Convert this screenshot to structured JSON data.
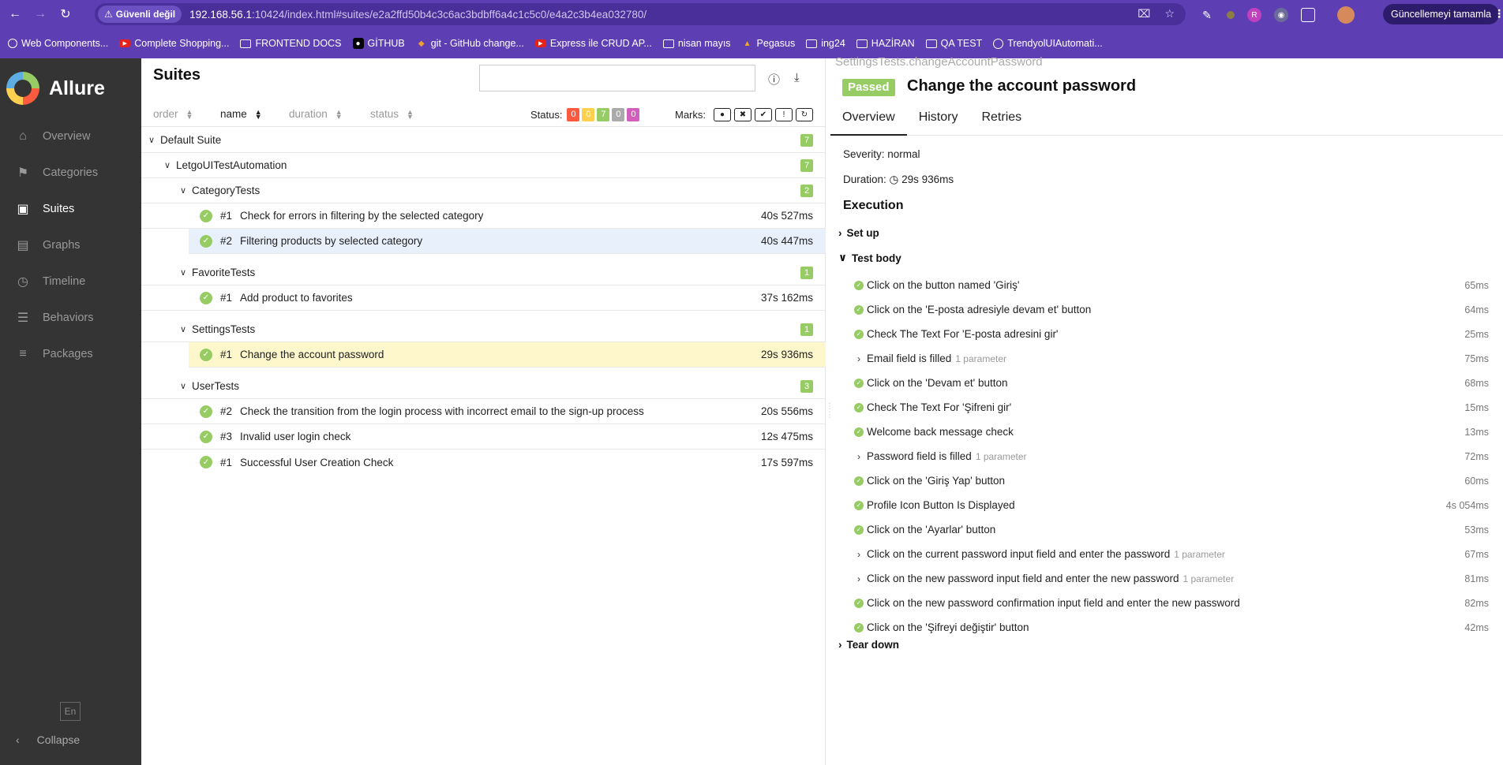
{
  "browser": {
    "security_label": "Güvenli değil",
    "url_host": "192.168.56.1",
    "url_rest": ":10424/index.html#suites/e2a2ffd50b4c3c6ac3bdbff6a4c1c5c0/e4a2c3b4ea032780/",
    "update_label": "Güncellemeyi tamamla",
    "bookmarks": [
      {
        "label": "Web Components..."
      },
      {
        "label": "Complete Shopping..."
      },
      {
        "label": "FRONTEND DOCS"
      },
      {
        "label": "GİTHUB"
      },
      {
        "label": "git - GitHub change..."
      },
      {
        "label": "Express ile CRUD AP..."
      },
      {
        "label": "nisan mayıs"
      },
      {
        "label": "Pegasus"
      },
      {
        "label": "ing24"
      },
      {
        "label": "HAZİRAN"
      },
      {
        "label": "QA TEST"
      },
      {
        "label": "TrendyolUIAutomati..."
      }
    ]
  },
  "sidebar": {
    "brand": "Allure",
    "items": [
      {
        "label": "Overview"
      },
      {
        "label": "Categories"
      },
      {
        "label": "Suites"
      },
      {
        "label": "Graphs"
      },
      {
        "label": "Timeline"
      },
      {
        "label": "Behaviors"
      },
      {
        "label": "Packages"
      }
    ],
    "lang": "En",
    "collapse": "Collapse"
  },
  "suites": {
    "title": "Suites",
    "sort": {
      "order": "order",
      "name": "name",
      "duration": "duration",
      "status": "status"
    },
    "status_label": "Status:",
    "status_counts": [
      {
        "value": "0",
        "color": "#fd5a3e"
      },
      {
        "value": "0",
        "color": "#ffd050"
      },
      {
        "value": "7",
        "color": "#97cc64"
      },
      {
        "value": "0",
        "color": "#aaaaaa"
      },
      {
        "value": "0",
        "color": "#d35ebe"
      }
    ],
    "marks_label": "Marks:",
    "default_suite": {
      "label": "Default Suite",
      "count": "7"
    },
    "project": {
      "label": "LetgoUITestAutomation",
      "count": "7"
    },
    "groups": [
      {
        "label": "CategoryTests",
        "count": "2",
        "tests": [
          {
            "num": "#1",
            "name": "Check for errors in filtering by the selected category",
            "duration": "40s 527ms"
          },
          {
            "num": "#2",
            "name": "Filtering products by selected category",
            "duration": "40s 447ms"
          }
        ]
      },
      {
        "label": "FavoriteTests",
        "count": "1",
        "tests": [
          {
            "num": "#1",
            "name": "Add product to favorites",
            "duration": "37s 162ms"
          }
        ]
      },
      {
        "label": "SettingsTests",
        "count": "1",
        "tests": [
          {
            "num": "#1",
            "name": "Change the account password",
            "duration": "29s 936ms"
          }
        ]
      },
      {
        "label": "UserTests",
        "count": "3",
        "tests": [
          {
            "num": "#2",
            "name": "Check the transition from the login process with incorrect email to the sign-up process",
            "duration": "20s 556ms"
          },
          {
            "num": "#3",
            "name": "Invalid user login check",
            "duration": "12s 475ms"
          },
          {
            "num": "#1",
            "name": "Successful User Creation Check",
            "duration": "17s 597ms"
          }
        ]
      }
    ]
  },
  "result": {
    "ghost_path": "SettingsTests.changeAccountPassword",
    "status": "Passed",
    "title": "Change the account password",
    "tabs": [
      "Overview",
      "History",
      "Retries"
    ],
    "severity": "Severity: normal",
    "duration_label": "Duration:",
    "duration_value": "29s 936ms",
    "execution": "Execution",
    "setup": "Set up",
    "test_body": "Test body",
    "teardown": "Tear down",
    "steps": [
      {
        "name": "Click on the button named 'Giriş'",
        "ms": "65ms",
        "param": ""
      },
      {
        "name": "Click on the 'E-posta adresiyle devam et' button",
        "ms": "64ms",
        "param": ""
      },
      {
        "name": "Check The Text For 'E-posta adresini gir'",
        "ms": "25ms",
        "param": ""
      },
      {
        "name": "Email field is filled",
        "ms": "75ms",
        "param": "1 parameter"
      },
      {
        "name": "Click on the 'Devam et' button",
        "ms": "68ms",
        "param": ""
      },
      {
        "name": "Check The Text For 'Şifreni gir'",
        "ms": "15ms",
        "param": ""
      },
      {
        "name": "Welcome back message check",
        "ms": "13ms",
        "param": ""
      },
      {
        "name": "Password field is filled",
        "ms": "72ms",
        "param": "1 parameter"
      },
      {
        "name": "Click on the 'Giriş Yap' button",
        "ms": "60ms",
        "param": ""
      },
      {
        "name": "Profile Icon Button Is Displayed",
        "ms": "4s 054ms",
        "param": ""
      },
      {
        "name": "Click on the 'Ayarlar' button",
        "ms": "53ms",
        "param": ""
      },
      {
        "name": "Click on the current password input field and enter the password",
        "ms": "67ms",
        "param": "1 parameter"
      },
      {
        "name": "Click on the new password input field and enter the new password",
        "ms": "81ms",
        "param": "1 parameter"
      },
      {
        "name": "Click on the new password confirmation input field and enter the new password",
        "ms": "82ms",
        "param": ""
      },
      {
        "name": "Click on the 'Şifreyi değiştir' button",
        "ms": "42ms",
        "param": ""
      }
    ]
  }
}
